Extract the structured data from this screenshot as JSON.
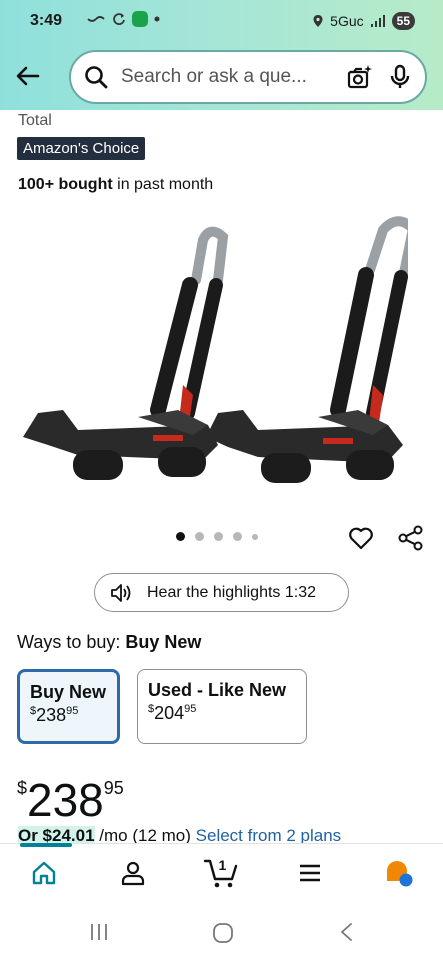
{
  "status": {
    "time": "3:49",
    "network": "5Guc",
    "battery": "55"
  },
  "header": {
    "search_placeholder": "Search or ask a que..."
  },
  "product": {
    "total_label": "Total",
    "badge": "Amazon's Choice",
    "bought_bold": "100+ bought",
    "bought_rest": " in past month",
    "image_icon": "kayak-rack-image",
    "carousel_dots": 5,
    "carousel_active": 1
  },
  "audio": {
    "label": "Hear the highlights 1:32"
  },
  "ways": {
    "prefix": "Ways to buy: ",
    "selected": "Buy New"
  },
  "options": [
    {
      "title": "Buy New",
      "currency": "$",
      "dollars": "238",
      "cents": "95"
    },
    {
      "title": "Used - Like New",
      "currency": "$",
      "dollars": "204",
      "cents": "95"
    }
  ],
  "price": {
    "currency": "$",
    "dollars": "238",
    "cents": "95"
  },
  "installment": {
    "amount": "Or $24.01",
    "terms": " /mo (12 mo) ",
    "link": "Select from 2 plans"
  },
  "bottom_nav": {
    "cart_count": "1",
    "items": [
      "home-icon",
      "account-icon",
      "cart-icon",
      "menu-icon",
      "rufus-icon"
    ]
  },
  "colors": {
    "accent": "#008296",
    "badge_bg": "#232f3e",
    "link": "#2162a1",
    "selected_border": "#2f6aa8",
    "rufus_orange": "#f08804",
    "rufus_blue": "#1e73d8"
  }
}
